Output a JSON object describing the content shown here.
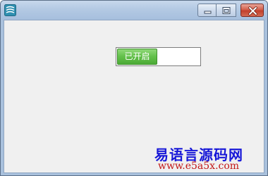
{
  "window": {
    "title": "",
    "controls": {
      "minimize": "minimize",
      "maximize": "maximize",
      "close": "close"
    }
  },
  "toggle": {
    "label": "已开启",
    "state": "on"
  },
  "watermark": {
    "title": "易语言源码网",
    "url": "www.e5a5x.com"
  },
  "colors": {
    "toggle_on": "#62c04a",
    "watermark_title": "#1717d8",
    "watermark_url": "#c21818",
    "client_bg": "#f0f0f0"
  },
  "icons": {
    "app": "app-icon",
    "minimize": "minimize-icon",
    "maximize": "maximize-icon",
    "close": "close-icon"
  }
}
